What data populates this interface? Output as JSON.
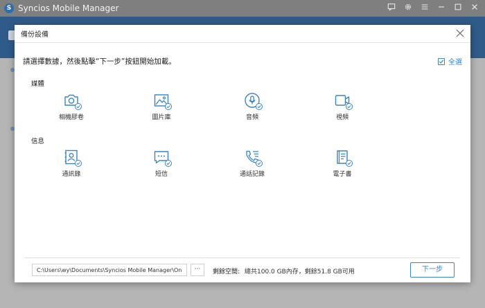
{
  "app": {
    "title": "Syncios Mobile Manager",
    "logo_letter": "S"
  },
  "modal": {
    "title": "備份設備",
    "instruction": "請選擇數據，然後點擊“下一步”按鈕開始加載。",
    "select_all_label": "全選",
    "sections": {
      "media": {
        "label": "媒體",
        "items": [
          {
            "label": "相機膠卷",
            "icon": "camera-icon"
          },
          {
            "label": "圖片庫",
            "icon": "image-icon"
          },
          {
            "label": "音頻",
            "icon": "microphone-icon"
          },
          {
            "label": "視頻",
            "icon": "video-icon"
          }
        ]
      },
      "info": {
        "label": "信息",
        "items": [
          {
            "label": "通訊錄",
            "icon": "contact-icon"
          },
          {
            "label": "短信",
            "icon": "message-icon"
          },
          {
            "label": "通話記錄",
            "icon": "phone-icon"
          },
          {
            "label": "電子書",
            "icon": "book-icon"
          }
        ]
      }
    },
    "footer": {
      "path_value": "C:\\Users\\wy\\Documents\\Syncios Mobile Manager\\One Key Ba",
      "browse_label": "···",
      "space_label": "剩餘空間:",
      "space_value": "總共100.0 GB內存，剩餘51.8 GB可用",
      "next_label": "下一步"
    }
  },
  "colors": {
    "accent": "#3a83c7",
    "overlay_bg": "#b5b5b5"
  }
}
